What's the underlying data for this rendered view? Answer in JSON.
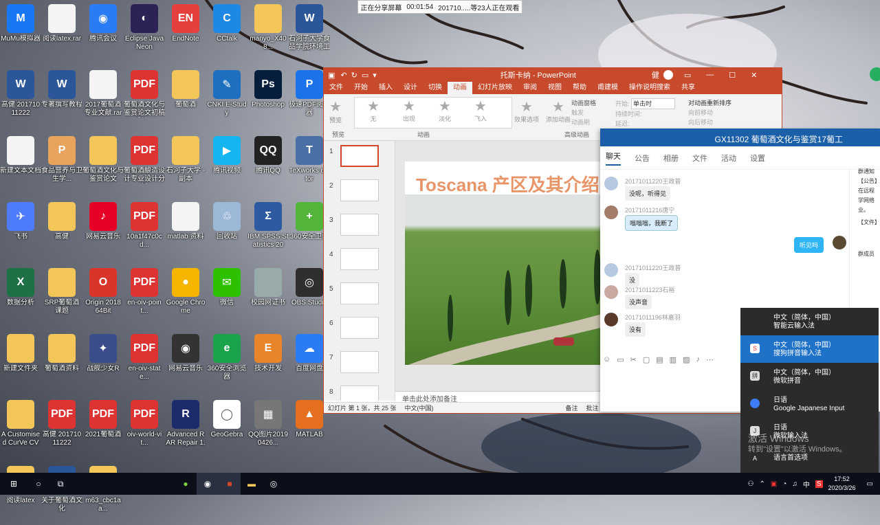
{
  "desktop": {
    "icons": [
      {
        "label": "MuMu模拟器",
        "color": "#1877f2",
        "glyph": "M"
      },
      {
        "label": "阅读latex.rar",
        "color": "#f4f4f4",
        "glyph": ""
      },
      {
        "label": "腾讯会议",
        "color": "#2a7bf6",
        "glyph": "◉"
      },
      {
        "label": "Eclipse Java Neon",
        "color": "#2c2255",
        "glyph": "◐"
      },
      {
        "label": "EndNote",
        "color": "#e6403e",
        "glyph": "EN"
      },
      {
        "label": "CCtalk",
        "color": "#1e88e5",
        "glyph": "C"
      },
      {
        "label": "manyo_X408...",
        "color": "#f3c65a",
        "glyph": ""
      },
      {
        "label": "石河子大学食品学院环境工程...",
        "color": "#2b579a",
        "glyph": "W"
      },
      {
        "label": "高健 20171011222",
        "color": "#2b579a",
        "glyph": "W"
      },
      {
        "label": "专著撰写教程",
        "color": "#2b579a",
        "glyph": "W"
      },
      {
        "label": "2017葡萄酒专业文献.rar",
        "color": "#f4f4f4",
        "glyph": ""
      },
      {
        "label": "葡萄酒文化与鉴赏论文初稿设计...",
        "color": "#d33",
        "glyph": "PDF"
      },
      {
        "label": "葡萄酒",
        "color": "#f3c65a",
        "glyph": ""
      },
      {
        "label": "CNKI E-Study",
        "color": "#1e6fbf",
        "glyph": "✎"
      },
      {
        "label": "Photoshop",
        "color": "#061e3c",
        "glyph": "Ps"
      },
      {
        "label": "极速PDF阅读器",
        "color": "#1a73e8",
        "glyph": "P"
      },
      {
        "label": "新建文本文档",
        "color": "#f4f4f4",
        "glyph": ""
      },
      {
        "label": "食品营养与卫生学...",
        "color": "#e8a35c",
        "glyph": "P"
      },
      {
        "label": "葡萄酒文化与鉴赏论文",
        "color": "#f3c65a",
        "glyph": ""
      },
      {
        "label": "葡萄酒酿造设计专业设计分析",
        "color": "#d33",
        "glyph": "PDF"
      },
      {
        "label": "石河子大学 - 副本",
        "color": "#f3c65a",
        "glyph": ""
      },
      {
        "label": "腾讯视频",
        "color": "#14b5f0",
        "glyph": "▶"
      },
      {
        "label": "腾讯QQ",
        "color": "#222",
        "glyph": "QQ"
      },
      {
        "label": "TeXworks editor",
        "color": "#4a6fa5",
        "glyph": "T"
      },
      {
        "label": "飞书",
        "color": "#4f7cff",
        "glyph": "✈"
      },
      {
        "label": "高健",
        "color": "#f3c65a",
        "glyph": ""
      },
      {
        "label": "网易云音乐",
        "color": "#e60026",
        "glyph": "♪"
      },
      {
        "label": "10a1f47c0cd...",
        "color": "#d33",
        "glyph": "PDF"
      },
      {
        "label": "matlab 资料",
        "color": "#f4f4f4",
        "glyph": ""
      },
      {
        "label": "回收站",
        "color": "#9bb8d6",
        "glyph": "♲"
      },
      {
        "label": "IBM SPSS Statistics 20",
        "color": "#2d5aa0",
        "glyph": "Σ"
      },
      {
        "label": "360安全卫士",
        "color": "#52b43b",
        "glyph": "+"
      },
      {
        "label": "数据分析",
        "color": "#1e7145",
        "glyph": "X"
      },
      {
        "label": "SRP葡萄酒课题",
        "color": "#f3c65a",
        "glyph": ""
      },
      {
        "label": "Origin 2018 64Bit",
        "color": "#d9352b",
        "glyph": "O"
      },
      {
        "label": "en-oiv-point...",
        "color": "#d33",
        "glyph": "PDF"
      },
      {
        "label": "Google Chrome",
        "color": "#f4b400",
        "glyph": "●"
      },
      {
        "label": "微信",
        "color": "#2dc100",
        "glyph": "✉"
      },
      {
        "label": "校园网证书",
        "color": "#9aa",
        "glyph": ""
      },
      {
        "label": "OBS Studio",
        "color": "#302e31",
        "glyph": "◎"
      },
      {
        "label": "新建文件夹",
        "color": "#f3c65a",
        "glyph": ""
      },
      {
        "label": "葡萄酒资料",
        "color": "#f3c65a",
        "glyph": ""
      },
      {
        "label": "战舰少女R",
        "color": "#3a4c8a",
        "glyph": "✦"
      },
      {
        "label": "en-oiv-state...",
        "color": "#d33",
        "glyph": "PDF"
      },
      {
        "label": "网易云音乐",
        "color": "#333",
        "glyph": "◉"
      },
      {
        "label": "360安全浏览器",
        "color": "#1aa34a",
        "glyph": "e"
      },
      {
        "label": "技术开发",
        "color": "#e8842a",
        "glyph": "E"
      },
      {
        "label": "百度网盘",
        "color": "#2a7bf6",
        "glyph": "☁"
      },
      {
        "label": "A Customised CurVe CV",
        "color": "#f3c65a",
        "glyph": ""
      },
      {
        "label": "高健 20171011222",
        "color": "#d33",
        "glyph": "PDF"
      },
      {
        "label": "2021葡萄酒",
        "color": "#d33",
        "glyph": "PDF"
      },
      {
        "label": "oiv-world-vit...",
        "color": "#d33",
        "glyph": "PDF"
      },
      {
        "label": "Advanced RAR Repair 1.20",
        "color": "#1c2b6b",
        "glyph": "R"
      },
      {
        "label": "GeoGebra",
        "color": "#ffffff",
        "glyph": "◯"
      },
      {
        "label": "QQ图片20190426...",
        "color": "#777",
        "glyph": "▦"
      },
      {
        "label": "MATLAB",
        "color": "#e46f1e",
        "glyph": "▲"
      },
      {
        "label": "阅读latex",
        "color": "#f3c65a",
        "glyph": ""
      },
      {
        "label": "关于葡萄酒文化",
        "color": "#2b579a",
        "glyph": "W"
      },
      {
        "label": "m63_cbc1aa...",
        "color": "#f3c65a",
        "glyph": ""
      }
    ]
  },
  "share_bar": {
    "status": "正在分享屏幕",
    "time": "00:01:54",
    "viewers": "201710.....等23人正在观看"
  },
  "powerpoint": {
    "title": "托斯卡纳 - PowerPoint",
    "user": "健",
    "tabs": [
      "文件",
      "开始",
      "插入",
      "设计",
      "切换",
      "动画",
      "幻灯片放映",
      "审阅",
      "视图",
      "帮助",
      "甫建模",
      "操作说明搜索",
      "共享"
    ],
    "active_tab": "动画",
    "ribbon": {
      "preview": "预览",
      "effects": [
        "无",
        "出现",
        "淡化",
        "飞入"
      ],
      "effect_options": "效果选项",
      "add_anim": "添加动画",
      "anim_pane": "动画窗格",
      "trigger": "触发",
      "anim_painter": "动画刷",
      "start": "开始:",
      "start_val": "单击时",
      "duration": "持续时间:",
      "delay": "延迟:",
      "reorder": "对动画重新排序",
      "move_earlier": "向前移动",
      "move_later": "向后移动",
      "group_preview": "预览",
      "group_anim": "动画",
      "group_adv": "高级动画"
    },
    "slide_title": "Toscana    产区及其介绍",
    "notes_placeholder": "单击此处添加备注",
    "status": {
      "slide": "幻灯片 第 1 张，共 25 张",
      "lang": "中文(中国)",
      "notes": "备注",
      "comments": "批注"
    },
    "slides": [
      "1",
      "2",
      "3",
      "4",
      "5",
      "6",
      "7",
      "8",
      "9"
    ]
  },
  "chat": {
    "group": "GX11302 葡萄酒文化与鉴赏17葡工",
    "tabs": [
      "聊天",
      "公告",
      "相册",
      "文件",
      "活动",
      "设置"
    ],
    "messages": [
      {
        "name": "20171011220王政普",
        "text": "没呢，听得见"
      },
      {
        "name": "20171011216唐宁",
        "text": "嗡嗡嗡，我断了"
      },
      {
        "name": "20171011220王政普",
        "text": "没"
      },
      {
        "name": "20171011223石裕",
        "text": "没声音"
      },
      {
        "name": "20171011196林嘉羽",
        "text": "没有"
      }
    ],
    "mine": "听见吗",
    "side": [
      "群通知",
      "【公告】",
      "在远程",
      "学网络",
      "业。",
      "【文件】"
    ],
    "members": "群成员"
  },
  "ime": {
    "items": [
      {
        "l1": "中文（简体，中国）",
        "l2": "智能云输入法",
        "icon": ""
      },
      {
        "l1": "中文（简体，中国）",
        "l2": "搜狗拼音输入法",
        "icon": "S"
      },
      {
        "l1": "中文（简体，中国）",
        "l2": "微软拼音",
        "icon": "拼"
      },
      {
        "l1": "日语",
        "l2": "Google Japanese Input",
        "icon": ""
      },
      {
        "l1": "日语",
        "l2": "微软输入法",
        "icon": "J"
      }
    ],
    "prefs": "语言首选项"
  },
  "watermark": {
    "l1": "激活 Windows",
    "l2": "转到\"设置\"以激活 Windows。"
  },
  "taskbar": {
    "ime_indicator": "中",
    "time": "17:52",
    "date": "2020/3/26"
  }
}
